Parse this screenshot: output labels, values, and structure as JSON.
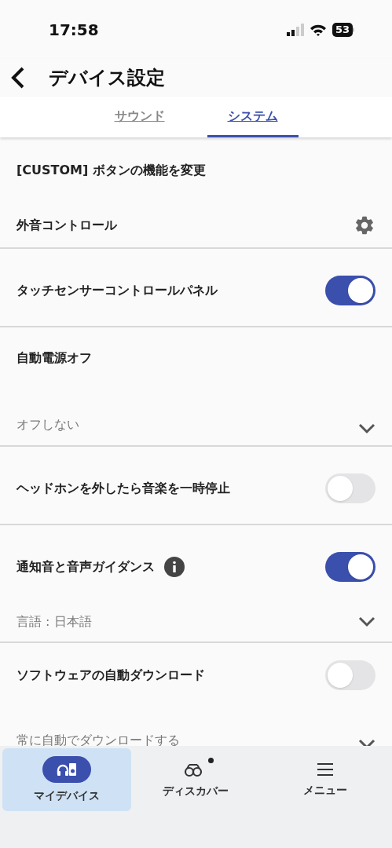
{
  "status_bar": {
    "time": "17:58",
    "battery": "53"
  },
  "header": {
    "title": "デバイス設定"
  },
  "tabs": [
    {
      "label": "サウンド",
      "selected": false
    },
    {
      "label": "システム",
      "selected": true
    }
  ],
  "sections": [
    {
      "rows": [
        {
          "kind": "link",
          "label": "[CUSTOM] ボタンの機能を変更"
        },
        {
          "kind": "gear",
          "label": "外音コントロール"
        }
      ]
    },
    {
      "rows": [
        {
          "kind": "toggle",
          "label": "タッチセンサーコントロールパネル",
          "on": true
        }
      ]
    },
    {
      "rows": [
        {
          "kind": "title",
          "label": "自動電源オフ"
        },
        {
          "kind": "select",
          "value": "オフしない"
        }
      ]
    },
    {
      "rows": [
        {
          "kind": "toggle",
          "label": "ヘッドホンを外したら音楽を一時停止",
          "on": false
        }
      ]
    },
    {
      "rows": [
        {
          "kind": "toggle",
          "label": "通知音と音声ガイダンス",
          "on": true,
          "info": true
        },
        {
          "kind": "select",
          "value": "言語 : 日本語"
        }
      ]
    },
    {
      "rows": [
        {
          "kind": "toggle",
          "label": "ソフトウェアの自動ダウンロード",
          "on": false
        },
        {
          "kind": "select",
          "value": "常に自動でダウンロードする"
        }
      ]
    }
  ],
  "nav": [
    {
      "kind": "device",
      "label": "マイデバイス",
      "selected": true
    },
    {
      "kind": "discover",
      "label": "ディスカバー",
      "selected": false,
      "dot": true
    },
    {
      "kind": "menu",
      "label": "メニュー",
      "selected": false
    }
  ]
}
